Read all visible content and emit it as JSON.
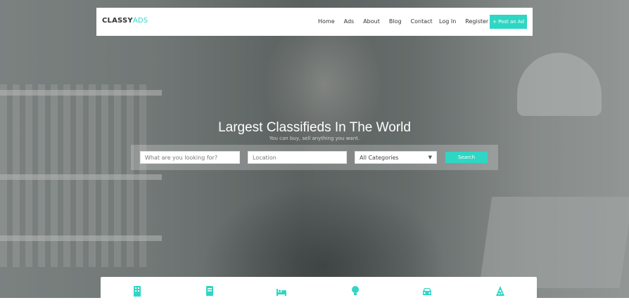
{
  "brand": {
    "logo_main": "CLASSY",
    "logo_accent": "ADS",
    "accent_color": "#2fd6c4"
  },
  "nav": {
    "links": [
      "Home",
      "Ads",
      "About",
      "Blog",
      "Contact"
    ],
    "login": "Log In",
    "register": "Register",
    "post_ad": "+ Post an Ad"
  },
  "hero": {
    "title": "Largest Classifieds In The World",
    "subtitle": "You can buy, sell anything you want."
  },
  "search": {
    "keyword_placeholder": "What are you looking for?",
    "location_placeholder": "Location",
    "category_selected": "All Categories",
    "button_label": "Search"
  },
  "categories_icons": [
    "building-icon",
    "book-icon",
    "bed-icon",
    "lightbulb-icon",
    "car-icon",
    "pizza-icon"
  ]
}
